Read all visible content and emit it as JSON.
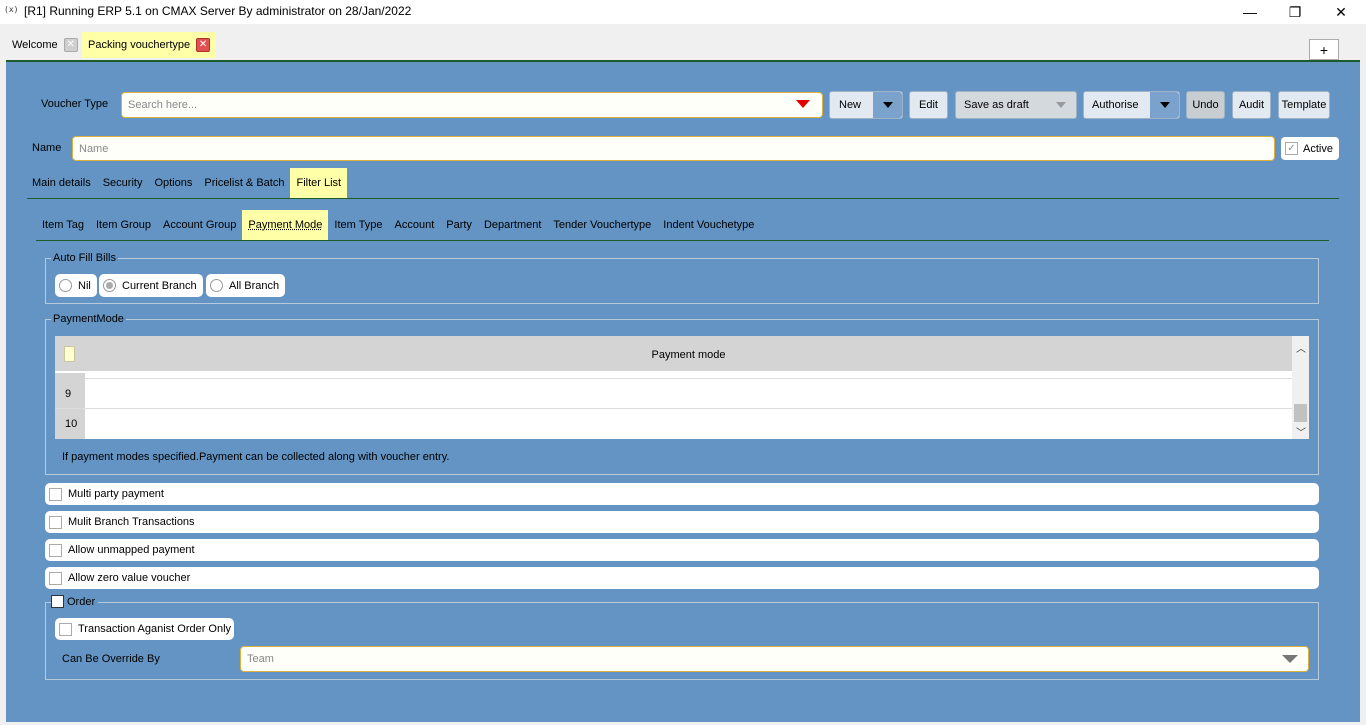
{
  "window": {
    "app_icon": "(x)",
    "title": "[R1] Running ERP 5.1 on CMAX Server By administrator on 28/Jan/2022",
    "minimize_glyph": "—",
    "maximize_glyph": "❐",
    "close_glyph": "✕"
  },
  "tabs": [
    {
      "label": "Welcome",
      "close": "✕"
    },
    {
      "label": "Packing vouchertype",
      "close": "✕"
    }
  ],
  "add_tab_label": "+",
  "toolbar": {
    "voucher_type_label": "Voucher Type",
    "search_placeholder": "Search here...",
    "new_label": "New",
    "edit_label": "Edit",
    "save_draft_label": "Save as draft",
    "authorise_label": "Authorise",
    "undo_label": "Undo",
    "audit_label": "Audit",
    "template_label": "Template"
  },
  "name_row": {
    "label": "Name",
    "placeholder": "Name",
    "active_label": "Active",
    "active_check": "✓"
  },
  "main_tabs": [
    "Main details",
    "Security",
    "Options",
    "Pricelist & Batch",
    "Filter List"
  ],
  "sub_tabs": [
    "Item Tag",
    "Item Group",
    "Account Group",
    "Payment Mode",
    "Item Type",
    "Account",
    "Party",
    "Department",
    "Tender Vouchertype",
    "Indent Vouchetype"
  ],
  "auto_fill": {
    "title": "Auto Fill Bills",
    "options": [
      "Nil",
      "Current Branch",
      "All Branch"
    ]
  },
  "payment_mode": {
    "title": "PaymentMode",
    "column_header": "Payment mode",
    "rows": [
      "9",
      "10"
    ],
    "note": "If payment modes specified.Payment can be collected along with voucher entry."
  },
  "options": [
    "Multi party payment",
    "Mulit Branch Transactions",
    "Allow unmapped payment",
    "Allow zero value voucher"
  ],
  "order": {
    "title": "Order",
    "transaction_label": "Transaction Aganist Order Only",
    "override_label": "Can Be Override By",
    "override_placeholder": "Team"
  },
  "colors": {
    "panel": "#6394c3",
    "highlight": "#ffffa8",
    "field_border": "#e0b03c",
    "separator": "#1f5a2a",
    "dropdown_arrow_red": "#e00000"
  }
}
